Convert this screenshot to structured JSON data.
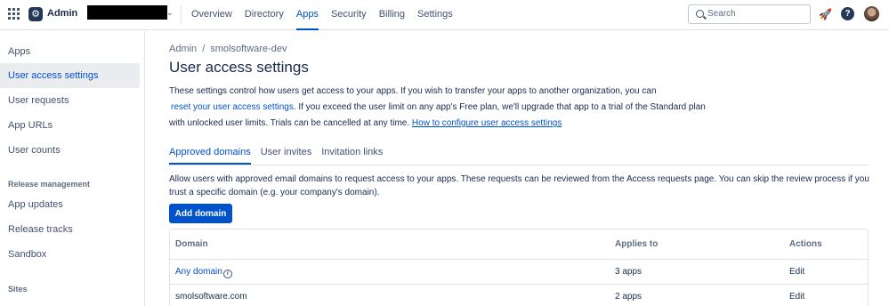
{
  "topbar": {
    "app_name": "Admin",
    "nav": [
      {
        "label": "Overview",
        "active": false
      },
      {
        "label": "Directory",
        "active": false
      },
      {
        "label": "Apps",
        "active": true
      },
      {
        "label": "Security",
        "active": false
      },
      {
        "label": "Billing",
        "active": false
      },
      {
        "label": "Settings",
        "active": false
      }
    ],
    "search_placeholder": "Search",
    "icons": [
      "app-switcher-icon",
      "admin-logo-icon",
      "chevron-down-icon",
      "search-icon",
      "notification-icon",
      "help-icon",
      "avatar"
    ],
    "accent_color": "#0052cc"
  },
  "sidebar": {
    "items": [
      {
        "label": "Apps",
        "active": false
      },
      {
        "label": "User access settings",
        "active": true
      },
      {
        "label": "User requests",
        "active": false
      },
      {
        "label": "App URLs",
        "active": false
      },
      {
        "label": "User counts",
        "active": false
      }
    ],
    "release_heading": "Release management",
    "release_items": [
      {
        "label": "App updates"
      },
      {
        "label": "Release tracks"
      },
      {
        "label": "Sandbox"
      }
    ],
    "sites_heading": "Sites"
  },
  "main": {
    "breadcrumb": [
      "Admin",
      "/",
      "smolsoftware-dev"
    ],
    "title": "User access settings",
    "desc_line1": "These settings control how users get access to your apps. If you wish to transfer your apps to another organization, you can",
    "desc_link1": "reset your user access settings",
    "desc_line2_rest": ". If you exceed the user limit on any app's Free plan, we'll upgrade that app to a trial of the Standard plan",
    "desc_line3": "with unlocked user limits. Trials can be cancelled at any time.",
    "desc_link2": "How to configure user access settings",
    "tabs": [
      {
        "label": "Approved domains",
        "active": true
      },
      {
        "label": "User invites",
        "active": false
      },
      {
        "label": "Invitation links",
        "active": false
      }
    ],
    "tab_description": "Allow users with approved email domains to request access to your apps. These requests can be reviewed from the Access requests page. You can skip the review process if you trust a specific domain (e.g. your company's domain).",
    "add_button": "Add domain",
    "table": {
      "headers": [
        "Domain",
        "Applies to",
        "Actions"
      ],
      "rows": [
        {
          "domain": "Any domain",
          "applies_to": "3 apps",
          "action": "Edit"
        },
        {
          "domain": "smolsoftware.com",
          "applies_to": "2 apps",
          "action": "Edit"
        }
      ]
    }
  }
}
